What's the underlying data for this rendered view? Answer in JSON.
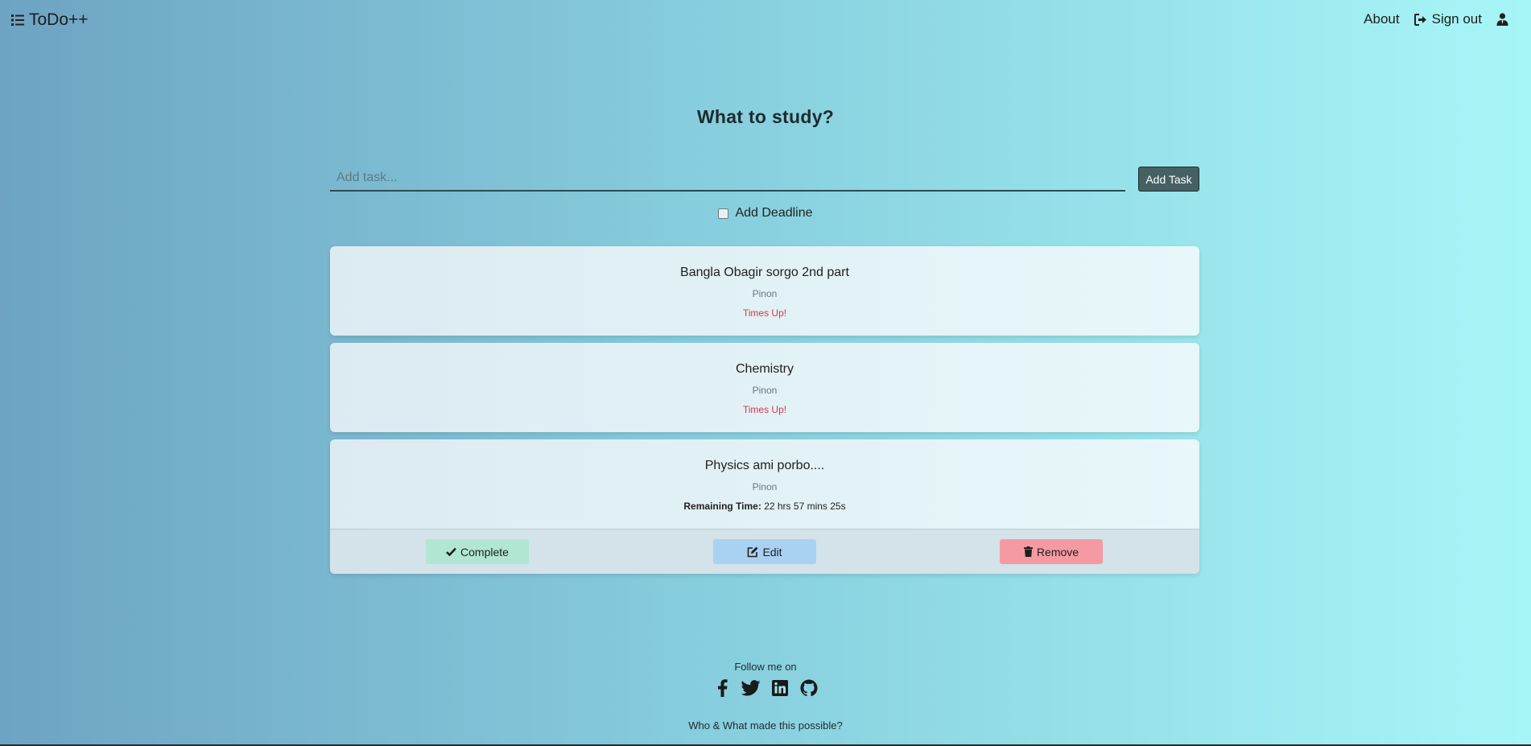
{
  "nav": {
    "brand": "ToDo++",
    "about": "About",
    "signout": "Sign out"
  },
  "main": {
    "heading": "What to study?",
    "input_placeholder": "Add task...",
    "add_button": "Add Task",
    "deadline_label": "Add Deadline"
  },
  "tasks": [
    {
      "title": "Bangla Obagir sorgo 2nd part",
      "owner": "Pinon",
      "status": "Times Up!"
    },
    {
      "title": "Chemistry",
      "owner": "Pinon",
      "status": "Times Up!"
    },
    {
      "title": "Physics ami porbo....",
      "owner": "Pinon",
      "remaining_label": "Remaining Time:",
      "remaining_value": "22 hrs 57 mins 25s"
    }
  ],
  "actions": {
    "complete": "Complete",
    "edit": "Edit",
    "remove": "Remove"
  },
  "footer": {
    "follow": "Follow me on",
    "credits": "Who & What made this possible?",
    "socials": [
      "facebook-icon",
      "twitter-icon",
      "linkedin-icon",
      "github-icon"
    ]
  },
  "colors": {
    "danger": "#dc3545",
    "complete_btn": "#b1e6d3",
    "edit_btn": "#a9d1f2",
    "remove_btn": "#f59aa3",
    "add_btn": "#466064"
  }
}
